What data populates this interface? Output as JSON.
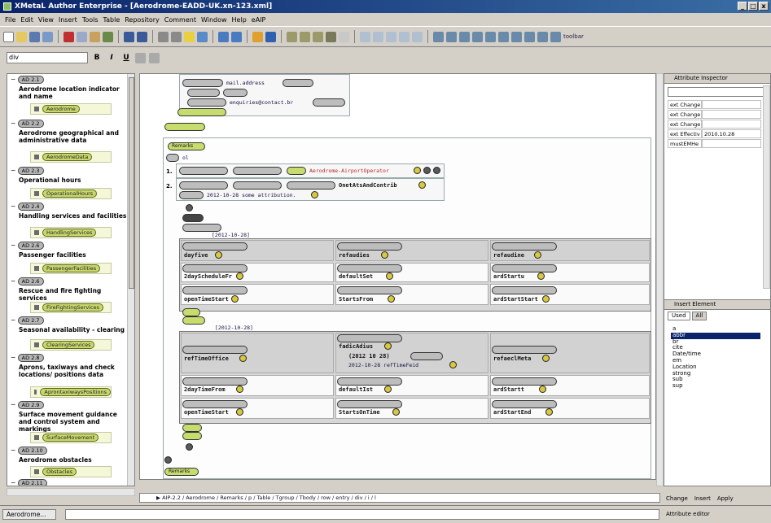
{
  "window": {
    "title": "XMetaL Author Enterprise - [Aerodrome-EADD-UK.xn-123.xml]",
    "controls": [
      "_",
      "□",
      "x"
    ]
  },
  "menu": [
    "File",
    "Edit",
    "View",
    "Insert",
    "Tools",
    "Table",
    "Repository",
    "Comment",
    "Window",
    "Help",
    "eAIP"
  ],
  "toolbar": {
    "text_label": "toolbar"
  },
  "format": {
    "style_value": "div",
    "bold": "B",
    "italic": "I",
    "underline": "U"
  },
  "left_tree": {
    "items": [
      {
        "code": "AD 2.1",
        "title": "Aerodrome location indicator and name",
        "node": "Aerodrome"
      },
      {
        "code": "AD 2.2",
        "title": "Aerodrome geographical and administrative data",
        "node": "AerodromeData"
      },
      {
        "code": "AD 2.3",
        "title": "Operational hours",
        "node": "OperationalHours"
      },
      {
        "code": "AD 2.4",
        "title": "Handling services and facilities",
        "node": "HandlingServices"
      },
      {
        "code": "AD 2.6",
        "title": "Passenger facilities",
        "node": "PassengerFacilities"
      },
      {
        "code": "AD 2.6",
        "title": "Rescue and fire fighting services",
        "node": "FireFightingServices"
      },
      {
        "code": "AD 2.7",
        "title": "Seasonal availability - clearing",
        "node": "ClearingServices"
      },
      {
        "code": "AD 2.8",
        "title": "Aprons, taxiways and check locations/ positions data",
        "node": "AprontaxiwaysPositions"
      },
      {
        "code": "AD 2.9",
        "title": "Surface movement guidance and control system and markings",
        "node": "SurfaceMovement"
      },
      {
        "code": "AD 2.10",
        "title": "Aerodrome obstacles",
        "node": "Obstacles"
      },
      {
        "code": "AD 2.11",
        "title": "",
        "node": ""
      }
    ]
  },
  "doc": {
    "email_value": "mail.address",
    "web_value": "enquiries@contact.br",
    "remarks_label": "Remarks",
    "list_item1_text": "Aerodrome-AirportOperator",
    "list_item2_text": "OnetAtsAndContrib",
    "list_item2_sub": "2012-10-28  some attribution.",
    "band1_title": "[2012-10-28]",
    "band2_title": "[2012-10-28]",
    "row_a": [
      "dayfive",
      "refaudies",
      "refaudine"
    ],
    "row_b": [
      "2dayScheduleFr",
      "defaultSet",
      "ardStartu"
    ],
    "row_c": [
      "openTimeStart",
      "StartsFrom",
      "ardStartStart"
    ],
    "row_d": [
      "refTimeOffice",
      "fadicAdius",
      "refaeclMeta"
    ],
    "row_d_extra": "(2012 10 28)",
    "row_d_extra2": "2012-10-28  refTimeFeid",
    "row_e": [
      "2dayTimeFrom",
      "defaultIst",
      "ardStartt"
    ],
    "row_f": [
      "openTimeStart",
      "StartsOnTime",
      "ardStartEnd"
    ],
    "meta_label": "Remarks"
  },
  "attr_inspector": {
    "title": "Attribute Inspector",
    "rows": [
      {
        "k": "ext Change",
        "v": ""
      },
      {
        "k": "ext Change",
        "v": ""
      },
      {
        "k": "ext Change",
        "v": ""
      },
      {
        "k": "ext Effectiv",
        "v": "2010.10.28"
      },
      {
        "k": "mustEMHe",
        "v": ""
      }
    ]
  },
  "insert_panel": {
    "title": "Insert Element",
    "tabs": [
      "Used",
      "All"
    ],
    "items": [
      "a",
      "abbr",
      "br",
      "cite",
      "Date/time",
      "em",
      "Location",
      "strong",
      "sub",
      "sup"
    ],
    "selected_index": 1,
    "change": "Change",
    "insert": "Insert",
    "apply": "Apply"
  },
  "breadcrumb": "▶ AIP-2.2 / Aerodrome / Remarks / p / Table / Tgroup / Tbody / row / entry / div / i / l",
  "status": {
    "task": "Aerodrome...",
    "right": "Attribute editor"
  }
}
